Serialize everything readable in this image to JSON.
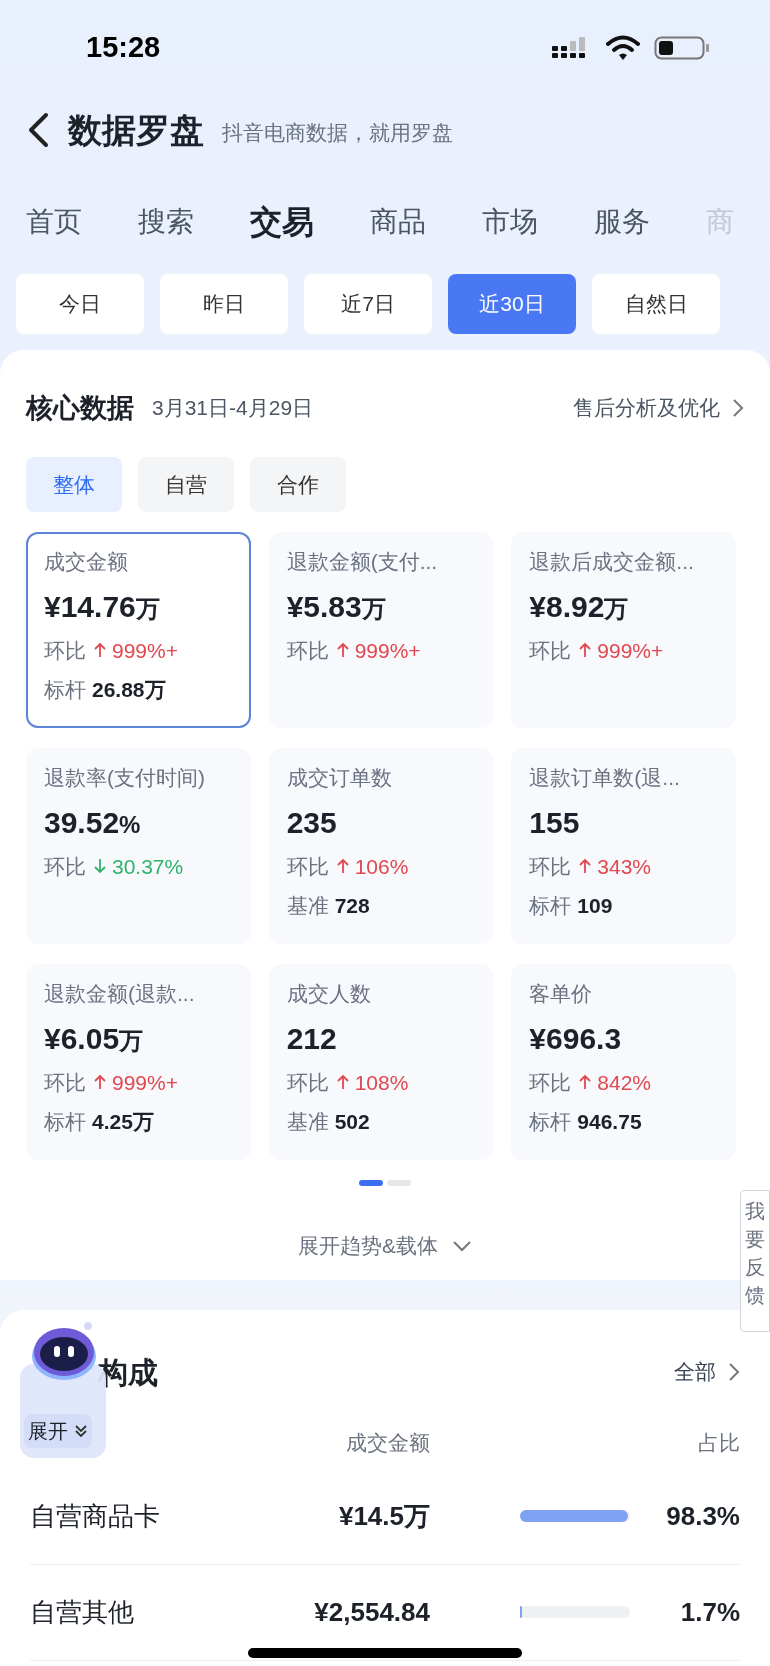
{
  "status_bar": {
    "time": "15:28"
  },
  "header": {
    "title": "数据罗盘",
    "subtitle": "抖音电商数据，就用罗盘"
  },
  "tabs": [
    {
      "label": "首页",
      "selected": false
    },
    {
      "label": "搜索",
      "selected": false
    },
    {
      "label": "交易",
      "selected": true
    },
    {
      "label": "商品",
      "selected": false
    },
    {
      "label": "市场",
      "selected": false
    },
    {
      "label": "服务",
      "selected": false
    },
    {
      "label": "商",
      "selected": false
    }
  ],
  "date_ranges": [
    {
      "label": "今日",
      "selected": false
    },
    {
      "label": "昨日",
      "selected": false
    },
    {
      "label": "近7日",
      "selected": false
    },
    {
      "label": "近30日",
      "selected": true
    },
    {
      "label": "自然日",
      "selected": false
    }
  ],
  "core_data": {
    "title": "核心数据",
    "date_range": "3月31日-4月29日",
    "link": "售后分析及优化",
    "segments": [
      {
        "label": "整体",
        "selected": true
      },
      {
        "label": "自营",
        "selected": false
      },
      {
        "label": "合作",
        "selected": false
      }
    ],
    "metrics": [
      {
        "label": "成交金额",
        "value": "¥14.76",
        "unit": "万",
        "selected": true,
        "change": {
          "label": "环比",
          "rising": true,
          "text": "999%+"
        },
        "benchmark": {
          "label": "标杆",
          "value": "26.88万"
        }
      },
      {
        "label": "退款金额(支付...",
        "value": "¥5.83",
        "unit": "万",
        "selected": false,
        "change": {
          "label": "环比",
          "rising": true,
          "text": "999%+"
        }
      },
      {
        "label": "退款后成交金额...",
        "value": "¥8.92",
        "unit": "万",
        "selected": false,
        "change": {
          "label": "环比",
          "rising": true,
          "text": "999%+"
        }
      },
      {
        "label": "退款率(支付时间)",
        "value": "39.52",
        "unit": "%",
        "selected": false,
        "change": {
          "label": "环比",
          "rising": false,
          "text": "30.37%"
        }
      },
      {
        "label": "成交订单数",
        "value": "235",
        "selected": false,
        "change": {
          "label": "环比",
          "rising": true,
          "text": "106%"
        },
        "benchmark": {
          "label": "基准",
          "value": "728"
        }
      },
      {
        "label": "退款订单数(退...",
        "value": "155",
        "selected": false,
        "change": {
          "label": "环比",
          "rising": true,
          "text": "343%"
        },
        "benchmark": {
          "label": "标杆",
          "value": "109"
        }
      },
      {
        "label": "退款金额(退款...",
        "value": "¥6.05",
        "unit": "万",
        "selected": false,
        "change": {
          "label": "环比",
          "rising": true,
          "text": "999%+"
        },
        "benchmark": {
          "label": "标杆",
          "value": "4.25万"
        }
      },
      {
        "label": "成交人数",
        "value": "212",
        "selected": false,
        "change": {
          "label": "环比",
          "rising": true,
          "text": "108%"
        },
        "benchmark": {
          "label": "基准",
          "value": "502"
        }
      },
      {
        "label": "客单价",
        "value": "¥696.3",
        "selected": false,
        "change": {
          "label": "环比",
          "rising": true,
          "text": "842%"
        },
        "benchmark": {
          "label": "标杆",
          "value": "946.75"
        }
      }
    ],
    "pages": [
      {
        "selected": true
      },
      {
        "selected": false
      }
    ],
    "expand": "展开趋势&载体"
  },
  "composition": {
    "title": "构成",
    "link": "全部",
    "columns": [
      "成交金额",
      "占比"
    ],
    "rows": [
      {
        "name": "自营商品卡",
        "amount": "¥14.5万",
        "level": 0.983,
        "share": "98.3%"
      },
      {
        "name": "自营其他",
        "amount": "¥2,554.84",
        "level": 0.017,
        "share": "1.7%"
      }
    ]
  },
  "assistant": {
    "button": "展开"
  },
  "feedback": {
    "label": "我要反馈"
  }
}
